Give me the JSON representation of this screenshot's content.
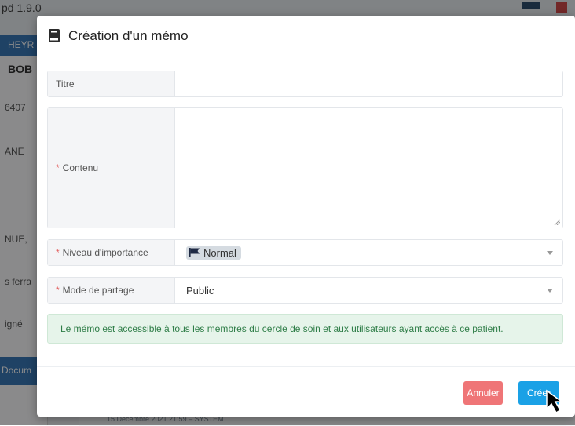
{
  "background": {
    "version_text": "pd 1.9.0",
    "strip_text": "HEYR",
    "patient_name": "BOB",
    "side_lines": [
      "6407",
      "ANE",
      "NUE,",
      "s ferra",
      "igné"
    ],
    "doc_button": "Docum",
    "footer_text": "15 Décembre 2021 21:59 – SYSTEM"
  },
  "modal": {
    "title": "Création d'un mémo",
    "title_icon": "book-icon",
    "fields": {
      "titre": {
        "label": "Titre",
        "value": "",
        "required": false
      },
      "contenu": {
        "label": "Contenu",
        "value": "",
        "required": true
      },
      "niveau": {
        "label": "Niveau d'importance",
        "value": "Normal",
        "icon": "flag-icon",
        "required": true
      },
      "partage": {
        "label": "Mode de partage",
        "value": "Public",
        "required": true
      }
    },
    "info_message": "Le mémo est accessible à tous les membres du cercle de soin et aux utilisateurs ayant accès à ce patient.",
    "buttons": {
      "cancel": "Annuler",
      "create": "Créer"
    }
  },
  "colors": {
    "cancel_button": "#ef7577",
    "create_button": "#1aa1e6",
    "info_bg": "#e6f4ea",
    "info_text": "#2e7d47",
    "required_star": "#e25d5d"
  }
}
